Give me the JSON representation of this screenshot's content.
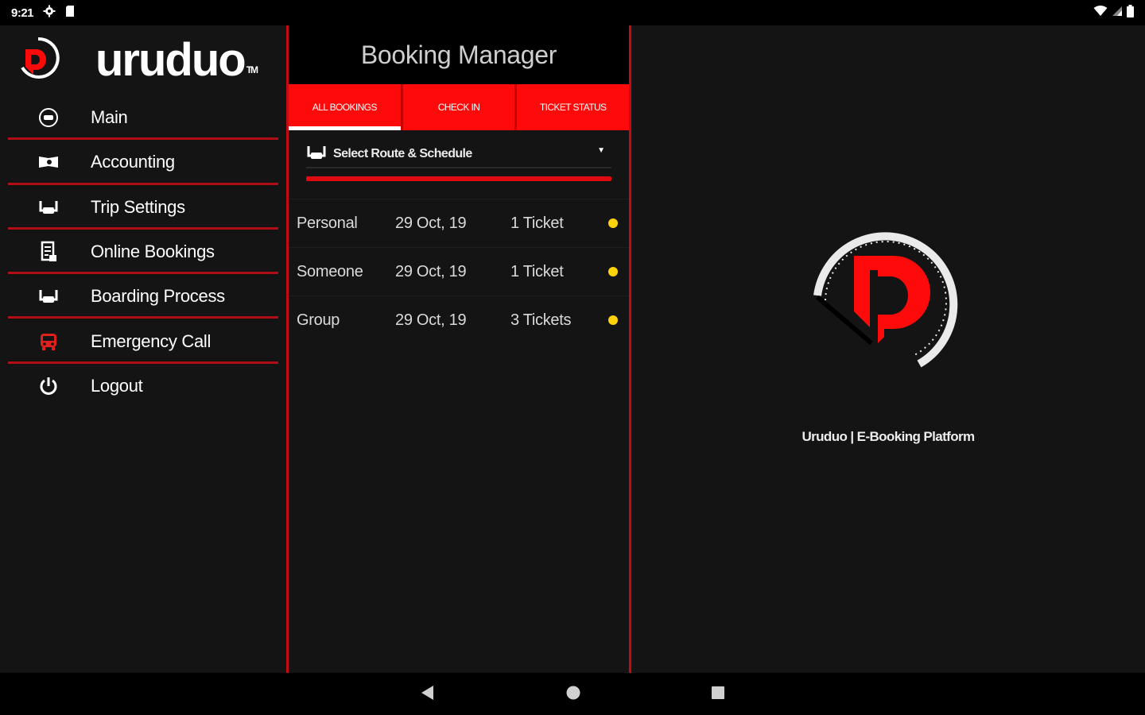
{
  "status_bar": {
    "time": "9:21"
  },
  "sidebar": {
    "logo_text": "uruduo",
    "logo_tm": "TM",
    "items": [
      {
        "label": "Main",
        "icon": "home-icon"
      },
      {
        "label": "Accounting",
        "icon": "cash-icon"
      },
      {
        "label": "Trip Settings",
        "icon": "seat-icon"
      },
      {
        "label": "Online Bookings",
        "icon": "receipt-icon"
      },
      {
        "label": "Boarding Process",
        "icon": "seat-icon"
      },
      {
        "label": "Emergency Call",
        "icon": "bus-icon"
      },
      {
        "label": "Logout",
        "icon": "power-icon"
      }
    ]
  },
  "booking_manager": {
    "title": "Booking Manager",
    "tabs": [
      {
        "label": "ALL BOOKINGS",
        "active": true
      },
      {
        "label": "CHECK IN",
        "active": false
      },
      {
        "label": "TICKET STATUS",
        "active": false
      }
    ],
    "route_select": {
      "placeholder": "Select Route & Schedule"
    },
    "bookings": [
      {
        "name": "Personal",
        "date": "29 Oct, 19",
        "tickets": "1 Ticket"
      },
      {
        "name": "Someone",
        "date": "29 Oct, 19",
        "tickets": "1 Ticket"
      },
      {
        "name": "Group",
        "date": "29 Oct, 19",
        "tickets": "3 Tickets"
      }
    ]
  },
  "right_panel": {
    "platform_label": "Uruduo | E-Booking Platform"
  },
  "colors": {
    "accent": "#ff0a0a",
    "separator": "#b00d15",
    "status_dot": "#ffd20a",
    "background": "#141414"
  }
}
